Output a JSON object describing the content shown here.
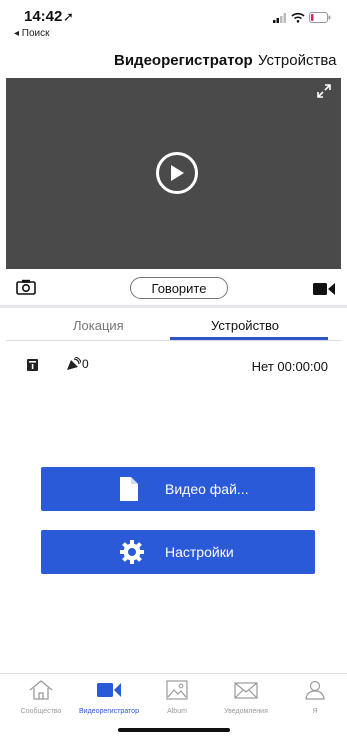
{
  "status_bar": {
    "time": "14:42",
    "back_label": "◂ Поиск"
  },
  "topnav": {
    "title": "Видеорегистратор",
    "devices": "Устройства"
  },
  "toolbar": {
    "talk_label": "Говорите"
  },
  "tabs": {
    "location": "Локация",
    "device": "Устройство"
  },
  "info": {
    "satellites": "0",
    "record_status": "Нет 00:00:00"
  },
  "buttons": {
    "video_files": "Видео фай...",
    "settings": "Настройки"
  },
  "bottom_nav": [
    {
      "label": "Сообщество",
      "icon": "home-icon",
      "active": false
    },
    {
      "label": "Видеорегистратор",
      "icon": "video-camera-icon",
      "active": true
    },
    {
      "label": "Album",
      "icon": "image-icon",
      "active": false
    },
    {
      "label": "Уведомления",
      "icon": "envelope-icon",
      "active": false
    },
    {
      "label": "Я",
      "icon": "person-icon",
      "active": false
    }
  ],
  "colors": {
    "accent": "#2b5ad8",
    "video_bg": "#4a4a4a"
  }
}
